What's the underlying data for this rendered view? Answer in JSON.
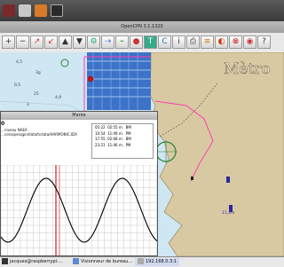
{
  "window": {
    "title": "OpenCPN 3.1.1320"
  },
  "chart": {
    "place_label": "Mètro",
    "depth_labels": [
      "4,5",
      "3g",
      "0,5",
      "25",
      "4,9",
      "09",
      "11,4m",
      "3",
      "2"
    ],
    "scale_label": "11.4m"
  },
  "tide": {
    "window_title": "Marée",
    "info_lines": [
      "…niveau NAEA",
      "…ces/openqpn/data/tcdata/HARMONIC.IDX"
    ],
    "zero_label": "0",
    "events": [
      {
        "time": "05:22",
        "height": "02:55 m.",
        "type": "BM"
      },
      {
        "time": "10:54",
        "height": "11:49 m.",
        "type": "PM"
      },
      {
        "time": "17:55",
        "height": "02:68 m.",
        "type": "BM"
      },
      {
        "time": "23:21",
        "height": "11:46 m.",
        "type": "PM"
      }
    ]
  },
  "taskbar": {
    "items": [
      "jacques@raspberrypi:…",
      "Visionneur de bureau…",
      "192.168.0.3:1"
    ]
  }
}
